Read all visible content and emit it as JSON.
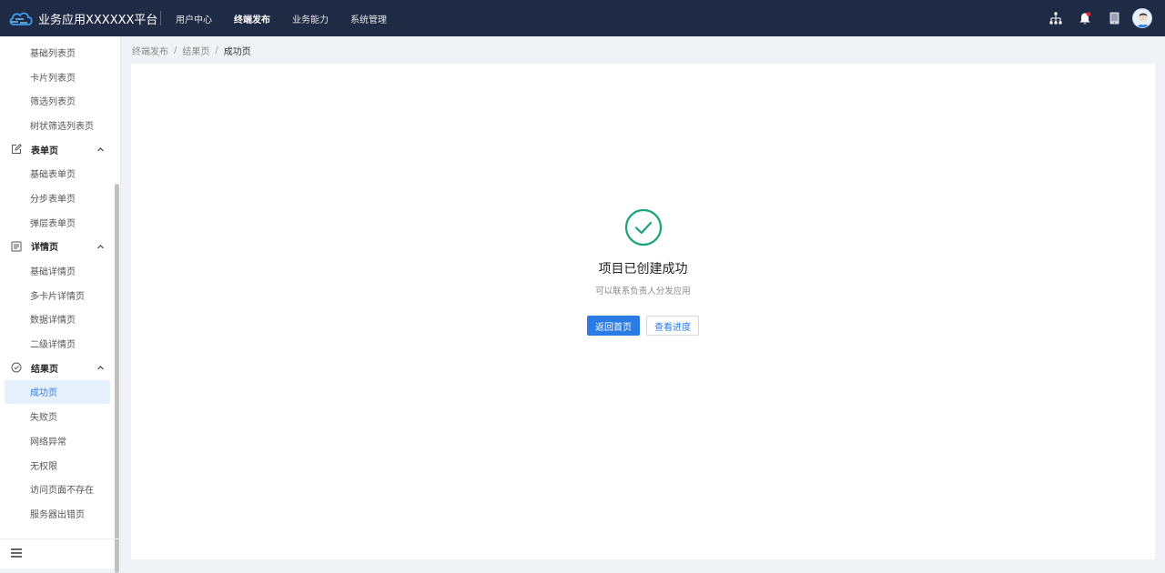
{
  "header": {
    "title": "业务应用XXXXXX平台",
    "nav": [
      {
        "label": "用户中心",
        "active": false
      },
      {
        "label": "终端发布",
        "active": true
      },
      {
        "label": "业务能力",
        "active": false
      },
      {
        "label": "系统管理",
        "active": false
      }
    ],
    "icons": [
      "org-tree-icon",
      "bell-icon",
      "tablet-icon",
      "avatar"
    ],
    "notification_dot_color": "#f5222d"
  },
  "sidebar": {
    "list_items": [
      "基础列表页",
      "卡片列表页",
      "筛选列表页",
      "树状筛选列表页"
    ],
    "form_group": {
      "label": "表单页",
      "icon": "edit-icon",
      "items": [
        "基础表单页",
        "分步表单页",
        "弹层表单页"
      ]
    },
    "detail_group": {
      "label": "详情页",
      "icon": "document-icon",
      "items": [
        "基础详情页",
        "多卡片详情页",
        "数据详情页",
        "二级详情页"
      ]
    },
    "result_group": {
      "label": "结果页",
      "icon": "check-circle-icon",
      "items": [
        "成功页",
        "失败页",
        "网络异常",
        "无权限",
        "访问页面不存在",
        "服务器出错页"
      ],
      "active_item": "成功页"
    },
    "footer_icon": "menu-icon"
  },
  "breadcrumb": [
    "终端发布",
    "结果页",
    "成功页"
  ],
  "breadcrumb_separator": "/",
  "result": {
    "icon": "success-check-icon",
    "title": "项目已创建成功",
    "description": "可以联系负责人分发应用",
    "primary_button": "返回首页",
    "secondary_button": "查看进度"
  },
  "colors": {
    "topbar": "#1f2a44",
    "accent": "#2b7be5",
    "success": "#1aa37a"
  }
}
